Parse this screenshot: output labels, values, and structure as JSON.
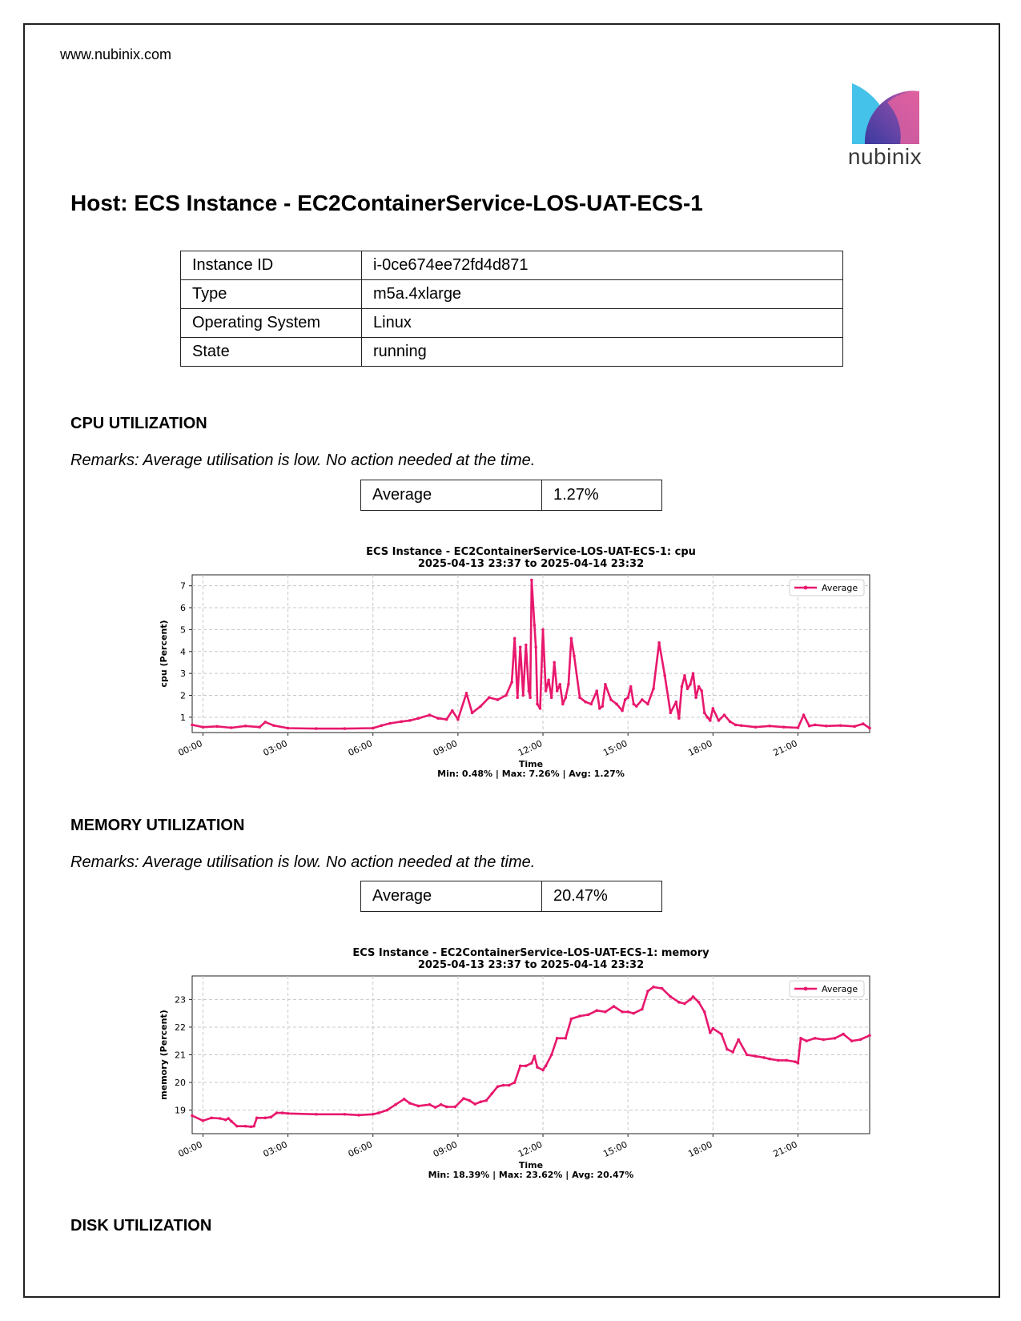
{
  "site_url": "www.nubinix.com",
  "logo": {
    "text": "nubinix",
    "colors": {
      "blue": "#45c2ea",
      "pink": "#e0609f",
      "purple": "#5a3fa0"
    }
  },
  "host_title": "Host: ECS Instance - EC2ContainerService-LOS-UAT-ECS-1",
  "instance_table": [
    {
      "key": "Instance ID",
      "value": "i-0ce674ee72fd4d871"
    },
    {
      "key": "Type",
      "value": "m5a.4xlarge"
    },
    {
      "key": "Operating System",
      "value": "Linux"
    },
    {
      "key": "State",
      "value": "running"
    }
  ],
  "sections": {
    "cpu": {
      "title": "CPU UTILIZATION",
      "remarks": "Remarks: Average utilisation is low. No action needed at the time.",
      "avg_label": "Average",
      "avg_value": "1.27%"
    },
    "memory": {
      "title": "MEMORY UTILIZATION",
      "remarks": "Remarks: Average utilisation is low. No action needed at the time.",
      "avg_label": "Average",
      "avg_value": "20.47%"
    },
    "disk": {
      "title": "DISK UTILIZATION"
    }
  },
  "chart_data": [
    {
      "type": "line",
      "title": "ECS Instance - EC2ContainerService-LOS-UAT-ECS-1: cpu",
      "subtitle": "2025-04-13 23:37 to 2025-04-14 23:32",
      "xlabel": "Time",
      "ylabel": "cpu (Percent)",
      "footer": "Min: 0.48% | Max: 7.26% | Avg: 1.27%",
      "legend": "top-right",
      "grid": true,
      "line_color": "#e8186d",
      "x_ticks": [
        "00:00",
        "03:00",
        "06:00",
        "09:00",
        "12:00",
        "15:00",
        "18:00",
        "21:00"
      ],
      "y_ticks": [
        1,
        2,
        3,
        4,
        5,
        6,
        7
      ],
      "xlim": [
        -0.38,
        23.53
      ],
      "ylim": [
        0.3,
        7.5
      ],
      "series": [
        {
          "name": "Average",
          "x": [
            -0.38,
            0.0,
            0.5,
            1.0,
            1.5,
            2.0,
            2.2,
            2.5,
            3.0,
            4.0,
            5.0,
            6.0,
            6.3,
            6.6,
            7.0,
            7.3,
            7.6,
            8.0,
            8.3,
            8.6,
            8.8,
            9.0,
            9.3,
            9.5,
            9.8,
            10.1,
            10.4,
            10.7,
            10.9,
            11.0,
            11.1,
            11.2,
            11.3,
            11.4,
            11.5,
            11.55,
            11.6,
            11.7,
            11.75,
            11.8,
            11.9,
            12.0,
            12.1,
            12.2,
            12.3,
            12.4,
            12.5,
            12.6,
            12.7,
            12.8,
            12.9,
            13.0,
            13.1,
            13.3,
            13.5,
            13.7,
            13.9,
            14.0,
            14.1,
            14.2,
            14.4,
            14.6,
            14.8,
            14.9,
            15.0,
            15.1,
            15.2,
            15.3,
            15.5,
            15.7,
            15.9,
            16.1,
            16.3,
            16.5,
            16.7,
            16.8,
            16.9,
            17.0,
            17.1,
            17.2,
            17.3,
            17.4,
            17.5,
            17.6,
            17.7,
            17.8,
            17.9,
            18.0,
            18.2,
            18.4,
            18.6,
            18.8,
            19.0,
            19.5,
            20.0,
            20.5,
            21.0,
            21.2,
            21.4,
            21.6,
            22.0,
            22.5,
            23.0,
            23.3,
            23.53
          ],
          "values": [
            0.65,
            0.55,
            0.58,
            0.52,
            0.6,
            0.55,
            0.78,
            0.62,
            0.5,
            0.48,
            0.48,
            0.5,
            0.62,
            0.72,
            0.8,
            0.85,
            0.95,
            1.1,
            0.95,
            0.9,
            1.3,
            0.9,
            2.1,
            1.2,
            1.5,
            1.9,
            1.8,
            2.0,
            2.6,
            4.6,
            1.9,
            4.2,
            2.0,
            4.3,
            2.2,
            1.9,
            7.26,
            5.2,
            4.2,
            1.6,
            1.4,
            5.0,
            2.2,
            2.7,
            1.9,
            3.5,
            2.2,
            2.5,
            1.6,
            1.9,
            2.5,
            4.6,
            3.8,
            1.9,
            1.7,
            1.6,
            2.2,
            1.4,
            1.5,
            2.5,
            1.8,
            1.6,
            1.3,
            1.8,
            1.9,
            2.4,
            1.6,
            1.5,
            1.8,
            1.6,
            2.3,
            4.4,
            2.9,
            1.2,
            1.7,
            0.95,
            2.4,
            2.9,
            2.3,
            2.5,
            3.0,
            1.9,
            2.4,
            2.2,
            1.2,
            1.0,
            0.85,
            1.4,
            0.85,
            1.1,
            0.8,
            0.65,
            0.62,
            0.55,
            0.6,
            0.55,
            0.52,
            1.1,
            0.6,
            0.65,
            0.6,
            0.62,
            0.58,
            0.7,
            0.5
          ]
        }
      ]
    },
    {
      "type": "line",
      "title": "ECS Instance - EC2ContainerService-LOS-UAT-ECS-1: memory",
      "subtitle": "2025-04-13 23:37 to 2025-04-14 23:32",
      "xlabel": "Time",
      "ylabel": "memory (Percent)",
      "footer": "Min: 18.39% | Max: 23.62% | Avg: 20.47%",
      "legend": "top-right",
      "grid": true,
      "line_color": "#e8186d",
      "x_ticks": [
        "00:00",
        "03:00",
        "06:00",
        "09:00",
        "12:00",
        "15:00",
        "18:00",
        "21:00"
      ],
      "y_ticks": [
        19,
        20,
        21,
        22,
        23
      ],
      "xlim": [
        -0.38,
        23.53
      ],
      "ylim": [
        18.15,
        23.85
      ],
      "series": [
        {
          "name": "Average",
          "x": [
            -0.38,
            0.0,
            0.3,
            0.6,
            0.8,
            0.9,
            1.0,
            1.2,
            1.5,
            1.7,
            1.8,
            1.9,
            2.2,
            2.4,
            2.6,
            2.8,
            3.0,
            4.0,
            5.0,
            5.5,
            6.0,
            6.2,
            6.5,
            6.8,
            7.1,
            7.3,
            7.6,
            8.0,
            8.2,
            8.4,
            8.6,
            8.9,
            9.2,
            9.4,
            9.6,
            9.8,
            10.0,
            10.2,
            10.4,
            10.6,
            10.8,
            11.0,
            11.2,
            11.4,
            11.6,
            11.7,
            11.8,
            12.0,
            12.1,
            12.3,
            12.5,
            12.8,
            13.0,
            13.3,
            13.6,
            13.9,
            14.2,
            14.5,
            14.8,
            15.0,
            15.2,
            15.5,
            15.7,
            15.9,
            16.2,
            16.5,
            16.8,
            17.0,
            17.2,
            17.3,
            17.5,
            17.7,
            17.9,
            18.0,
            18.3,
            18.5,
            18.7,
            18.9,
            19.2,
            19.5,
            19.8,
            20.0,
            20.3,
            20.6,
            20.9,
            21.0,
            21.1,
            21.3,
            21.6,
            21.9,
            22.3,
            22.6,
            22.9,
            23.2,
            23.53
          ],
          "values": [
            18.8,
            18.62,
            18.72,
            18.7,
            18.65,
            18.7,
            18.6,
            18.42,
            18.42,
            18.4,
            18.42,
            18.72,
            18.72,
            18.75,
            18.9,
            18.9,
            18.88,
            18.85,
            18.85,
            18.82,
            18.85,
            18.9,
            19.0,
            19.2,
            19.4,
            19.25,
            19.15,
            19.2,
            19.1,
            19.2,
            19.12,
            19.12,
            19.42,
            19.35,
            19.22,
            19.3,
            19.35,
            19.6,
            19.85,
            19.9,
            19.9,
            20.0,
            20.6,
            20.6,
            20.7,
            20.95,
            20.55,
            20.45,
            20.6,
            21.0,
            21.6,
            21.6,
            22.3,
            22.4,
            22.45,
            22.6,
            22.55,
            22.75,
            22.55,
            22.55,
            22.5,
            22.65,
            23.3,
            23.45,
            23.4,
            23.1,
            22.9,
            22.85,
            23.0,
            23.1,
            22.9,
            22.55,
            21.8,
            21.95,
            21.75,
            21.2,
            21.1,
            21.55,
            21.0,
            20.95,
            20.9,
            20.85,
            20.8,
            20.8,
            20.75,
            20.7,
            21.6,
            21.5,
            21.6,
            21.55,
            21.6,
            21.75,
            21.5,
            21.55,
            21.7
          ]
        }
      ]
    }
  ]
}
